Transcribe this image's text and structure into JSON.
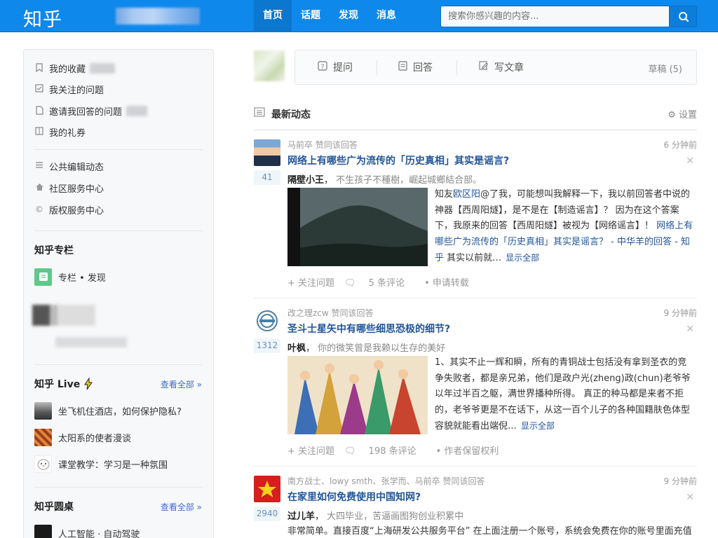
{
  "header": {
    "logo": "知乎",
    "nav": [
      "首页",
      "话题",
      "发现",
      "消息"
    ],
    "search_placeholder": "搜索你感兴趣的内容..."
  },
  "sidebar": {
    "links_top": [
      "我的收藏",
      "我关注的问题",
      "邀请我回答的问题",
      "我的礼券"
    ],
    "links_mid": [
      "公共编辑动态",
      "社区服务中心",
      "版权服务中心"
    ],
    "column_title": "知乎专栏",
    "column_item": "专栏 • 发现",
    "live_title": "知乎 Live",
    "live_see_all": "查看全部 »",
    "live_items": [
      "坐飞机住酒店，如何保护隐私?",
      "太阳系的使者漫谈",
      "课堂教学：学习是一种氛围"
    ],
    "roundtable_title": "知乎圆桌",
    "roundtable_see_all": "查看全部 »",
    "roundtable_items": [
      "人工智能 · 自动驾驶"
    ]
  },
  "compose": {
    "ask": "提问",
    "answer": "回答",
    "write": "写文章",
    "draft": "草稿 (5)"
  },
  "feed": {
    "title": "最新动态",
    "settings": "设置",
    "items": [
      {
        "meta": "马前卒 赞同该回答",
        "time": "6 分钟前",
        "question": "网络上有哪些广为流传的「历史真相」其实是谣言?",
        "votes": "41",
        "author": "隔壁小王",
        "bio": "不生孩子不種樹，崛起城鄉結合部。",
        "summary_a": "知友",
        "summary_mention": "欧区阳",
        "summary_b": "@了我，可能想叫我解释一下，我以前回答者中说的神器【西周阳燧】，是不是在【制造谣言】？ 因为在这个答案下，我原来的回答【西周阳燧】被视为【网络谣言】！ ",
        "summary_link": "网络上有哪些广为流传的「历史真相」其实是谣言？ - 中华羊的回答 - 知乎",
        "summary_c": " 其实以前就…",
        "more": "显示全部",
        "actions": [
          "+ 关注问题",
          "5 条评论",
          "• 申请转载"
        ]
      },
      {
        "meta": "改之理zcw 赞同该回答",
        "time": "9 分钟前",
        "question": "圣斗士星矢中有哪些细思恐极的细节?",
        "votes": "1312",
        "author": "叶枫",
        "bio": "你的微笑曾是我赖以生存的美好",
        "summary": "1、其实不止一辉和瞬，所有的青铜战士包括没有拿到圣衣的竞争失败者，都是亲兄弟，他们是政户光(zheng)政(chun)老爷爷以年过半百之躯，满世界播种所得。 真正的种马都是来者不拒的，老爷爷更是不在话下，从这一百个儿子的各种国籍肤色体型容貌就能看出端倪…",
        "more": "显示全部",
        "actions": [
          "+ 关注问题",
          "198 条评论",
          "• 作者保留权利"
        ]
      },
      {
        "meta": "南方战士、lowy smth、张学而、马前卒 赞同该回答",
        "time": "9 分钟前",
        "question": "在家里如何免费使用中国知网?",
        "votes": "2940",
        "author": "过儿羊",
        "bio": "大四毕业，苦逼画图狗创业积累中",
        "summary": "非常简单。直接百度“上海研发公共服务平台” 在上面注册一个账号，系统会免费在你的账号里面充值"
      }
    ]
  },
  "colors": {
    "brand": "#0f88eb",
    "link": "#225599"
  }
}
